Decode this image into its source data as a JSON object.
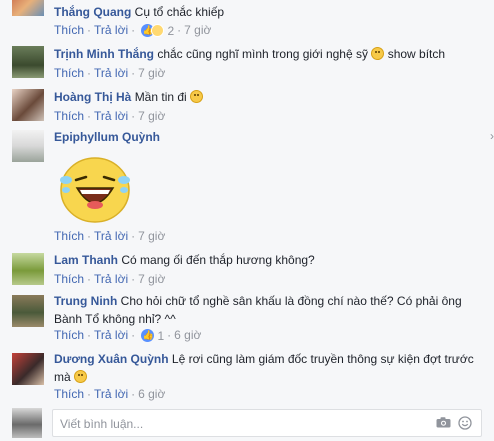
{
  "comments": [
    {
      "author": "Thắng Quang",
      "text": "Cụ tổ chắc khiếp",
      "like": "Thích",
      "reply": "Trả lời",
      "count": "2",
      "time": "7 giờ"
    },
    {
      "author": "Trịnh Minh Thắng",
      "text": "chắc cũng nghĩ mình trong giới nghệ sỹ",
      "text2": "show bítch",
      "like": "Thích",
      "reply": "Trả lời",
      "time": "7 giờ"
    },
    {
      "author": "Hoàng Thị Hà",
      "text": "Mần tin đi",
      "like": "Thích",
      "reply": "Trả lời",
      "time": "7 giờ"
    },
    {
      "author": "Epiphyllum Quỳnh",
      "text": "",
      "like": "Thích",
      "reply": "Trả lời",
      "time": "7 giờ"
    },
    {
      "author": "Lam Thanh",
      "text": "Có mang ối đến thắp hương không?",
      "like": "Thích",
      "reply": "Trả lời",
      "time": "7 giờ"
    },
    {
      "author": "Trung Ninh",
      "text": "Cho hỏi chữ tổ nghề sân khấu là đồng chí nào thế? Có phải ông",
      "text_line2": "Bành Tổ không nhỉ? ^^",
      "like": "Thích",
      "reply": "Trả lời",
      "count": "1",
      "time": "6 giờ"
    },
    {
      "author": "Dương Xuân Quỳnh",
      "text": "Lệ rơi cũng làm giám đốc truyền thông sự kiện đợt trước",
      "text_line2": "mà",
      "like": "Thích",
      "reply": "Trả lời",
      "time": "6 giờ"
    }
  ],
  "composer": {
    "placeholder": "Viết bình luận..."
  },
  "colors": {
    "author": "#365899",
    "link": "#4267b2",
    "meta": "#90949c"
  }
}
